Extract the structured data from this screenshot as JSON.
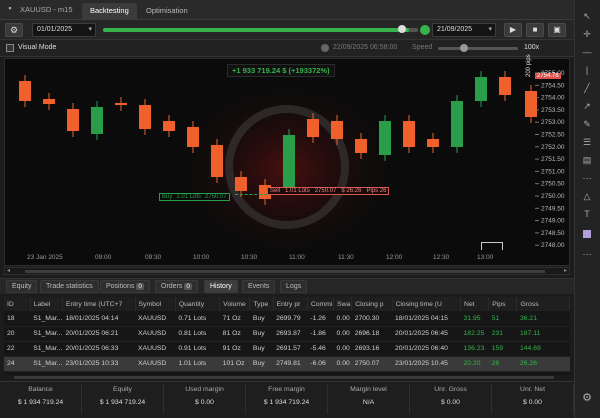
{
  "window": {
    "title": "XAUUSD - m15",
    "tabs": [
      "Backtesting",
      "Optimisation"
    ],
    "active_tab": "Backtesting"
  },
  "controls": {
    "start_date": "01/01/2025",
    "end_date": "21/09/2025",
    "progress": 0.97
  },
  "visual": {
    "label": "Visual Mode",
    "time": "22/09/2025 06:58:00",
    "speed_label": "Speed",
    "speed_value": "100x"
  },
  "chart": {
    "pnl_banner": "+1 933 719.24 $ (+193372%)",
    "price_labels": [
      "2755.00",
      "2754.50",
      "2754.00",
      "2753.50",
      "2753.00",
      "2752.50",
      "2752.00",
      "2751.50",
      "2751.00",
      "2750.50",
      "2750.00",
      "2749.50",
      "2749.00",
      "2748.50",
      "2748.00"
    ],
    "time_labels": [
      "23 Jan 2025",
      "09:00",
      "09:30",
      "10:00",
      "10:30",
      "11:00",
      "11:30",
      "12:00",
      "12:30",
      "13:00"
    ],
    "current_price": "2754.78",
    "pips_tag": "200 pips",
    "trade_buy": {
      "side": "Buy",
      "lots": "1.01 Lots",
      "price": "2750.07"
    },
    "trade_sell": {
      "side": "Sell",
      "lots": "1.01 Lots",
      "price": "2750.07",
      "pnl": "$ 26.26",
      "pips": "Pips 26"
    }
  },
  "bottom_tabs": [
    {
      "label": "Equity"
    },
    {
      "label": "Trade statistics"
    },
    {
      "label": "Positions",
      "count": "0"
    },
    {
      "label": "Orders",
      "count": "0"
    },
    {
      "label": "History"
    },
    {
      "label": "Events"
    },
    {
      "label": "Logs"
    }
  ],
  "history": {
    "columns": [
      "ID",
      "Label",
      "Entry time (UTC+7",
      "Symbol",
      "Quantity",
      "Volume",
      "Type",
      "Entry pr",
      "Commi",
      "Swa",
      "Closing p",
      "Closing time (U",
      "Net",
      "Pips",
      "Gross"
    ],
    "rows": [
      [
        "18",
        "S1_Mar...",
        "18/01/2025 04:14",
        "XAUUSD",
        "0.71 Lots",
        "71 Oz",
        "Buy",
        "2699.79",
        "-1.26",
        "0.00",
        "2700.30",
        "18/01/2025 04:15",
        "31.95",
        "51",
        "36.21"
      ],
      [
        "20",
        "S1_Mar...",
        "20/01/2025 06:21",
        "XAUUSD",
        "0.81 Lots",
        "81 Oz",
        "Buy",
        "2693.87",
        "-1.86",
        "0.00",
        "2696.18",
        "20/01/2025 06:45",
        "182.25",
        "231",
        "187.11"
      ],
      [
        "22",
        "S1_Mar...",
        "20/01/2025 06:33",
        "XAUUSD",
        "0.91 Lots",
        "91 Oz",
        "Buy",
        "2691.57",
        "-5.46",
        "0.00",
        "2693.16",
        "20/01/2025 06:40",
        "136.23",
        "159",
        "144.69"
      ],
      [
        "24",
        "S1_Mar...",
        "23/01/2025 10:33",
        "XAUUSD",
        "1.01 Lots",
        "101 Oz",
        "Buy",
        "2749.81",
        "-6.06",
        "0.00",
        "2750.07",
        "23/01/2025 10.45",
        "20.20",
        "26",
        "26.26"
      ]
    ],
    "selected_row": 3
  },
  "footer": {
    "items": [
      {
        "label": "Balance",
        "value": "$ 1 934 719.24"
      },
      {
        "label": "Equity",
        "value": "$ 1 934 719.24"
      },
      {
        "label": "Used margin",
        "value": "$ 0.00"
      },
      {
        "label": "Free margin",
        "value": "$ 1 934 719.24"
      },
      {
        "label": "Margin level",
        "value": "N/A"
      },
      {
        "label": "Unr. Gross",
        "value": "$ 0.00"
      },
      {
        "label": "Unr. Net",
        "value": "$ 0.00"
      }
    ]
  },
  "colors": {
    "up": "#2a9d4a",
    "down": "#f0602a",
    "accent": "#37b24d",
    "sell_tag": "#d9534f"
  }
}
